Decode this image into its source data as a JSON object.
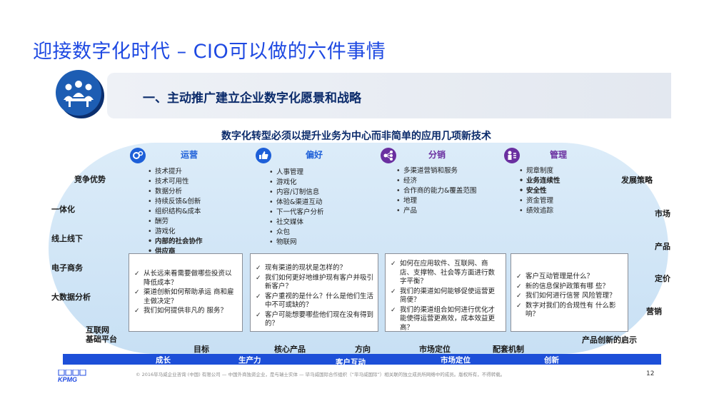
{
  "title": "迎接数字化时代 – CIO可以做的六件事情",
  "banner": "一、主动推广建立企业数字化愿景和战略",
  "subtitle": "数字化转型必须以提升业务为中心而非简单的应用几项新技术",
  "categories": [
    {
      "label": "运营",
      "icon": "gears-icon",
      "color": "#1d5fd8"
    },
    {
      "label": "偏好",
      "icon": "thumbs-up-icon",
      "color": "#1d5fd8"
    },
    {
      "label": "分销",
      "icon": "network-icon",
      "color": "#6a2fa0"
    },
    {
      "label": "管理",
      "icon": "people-icon",
      "color": "#6a2fa0"
    }
  ],
  "lists": {
    "operations": [
      "技术提升",
      "技术可用性",
      "数据分析",
      "持续反馈&创新",
      "组织结构&成本",
      "酬劳",
      "游戏化",
      "内部的社会协作",
      "供应商"
    ],
    "preferences": [
      "人事管理",
      "游戏化",
      "内容/订制信息",
      "体验&渠道互动",
      "下一代客户分析",
      "社交媒体",
      "众包",
      "物联网"
    ],
    "distribution": [
      "多渠道营销和服务",
      "经济",
      "合作商的能力&覆盖范围",
      "地理",
      "产品"
    ],
    "management": [
      "规章制度",
      "业务连续性",
      "安全性",
      "资金管理",
      "绩效追踪"
    ]
  },
  "questions": {
    "box1": [
      "从长远来看需要做哪些投资以降低成本？",
      "渠道创新如何帮助承运 商和雇主做决定？",
      "我们如何提供非凡的 服务？"
    ],
    "box2": [
      "现有渠道的现状是怎样的？",
      "我们如何更好地维护现有客户并吸引新客户？",
      "客户重视的是什么？什么是他们生活中不可或缺的？",
      "客户可能想要哪些他们现在没有得到的？"
    ],
    "box3": [
      "如何在应用软件、互联网、商店、支撑物、社会等方面进行数字平衡？",
      "我们的渠道如何能够促使运营更简便？",
      "我们的渠道组合如何进行优化才能使得运营更高效，成本效益更高？"
    ],
    "box4": [
      "客户互动管理是什么？",
      "新的信息保护政策有哪 些？",
      "我们如何进行信誉 风险管理？",
      "数字对我们的合规性有 什么影响？"
    ]
  },
  "left_labels": [
    "竞争优势",
    "一体化",
    "线上线下",
    "电子商务",
    "大数据分析",
    "互联网",
    "基础平台"
  ],
  "right_labels": [
    "发展策略",
    "市场",
    "产品",
    "定价",
    "营销",
    "产品创新的启示"
  ],
  "bottom_labels": [
    "目标",
    "核心产品",
    "方向",
    "市场定位",
    "配套机制"
  ],
  "bar_labels": [
    "成长",
    "生产力",
    "客户互动",
    "市场定位",
    "创新"
  ],
  "footer": "© 2016毕马威企业咨询 (中国) 有限公司 — 中国外商独资企业，是与瑞士实体 — 毕马威国际合作组织（“毕马威国际”）相关联的独立成员所网络中的成员。版权所有，不得转载。",
  "page_number": "12",
  "logo_text": "KPMG",
  "colors": {
    "title": "#1e49e2",
    "bar": "#1d4fd8",
    "oval": "#cfe4f6",
    "icon_blue": "#1d5fd8",
    "icon_purple": "#6a2fa0"
  }
}
